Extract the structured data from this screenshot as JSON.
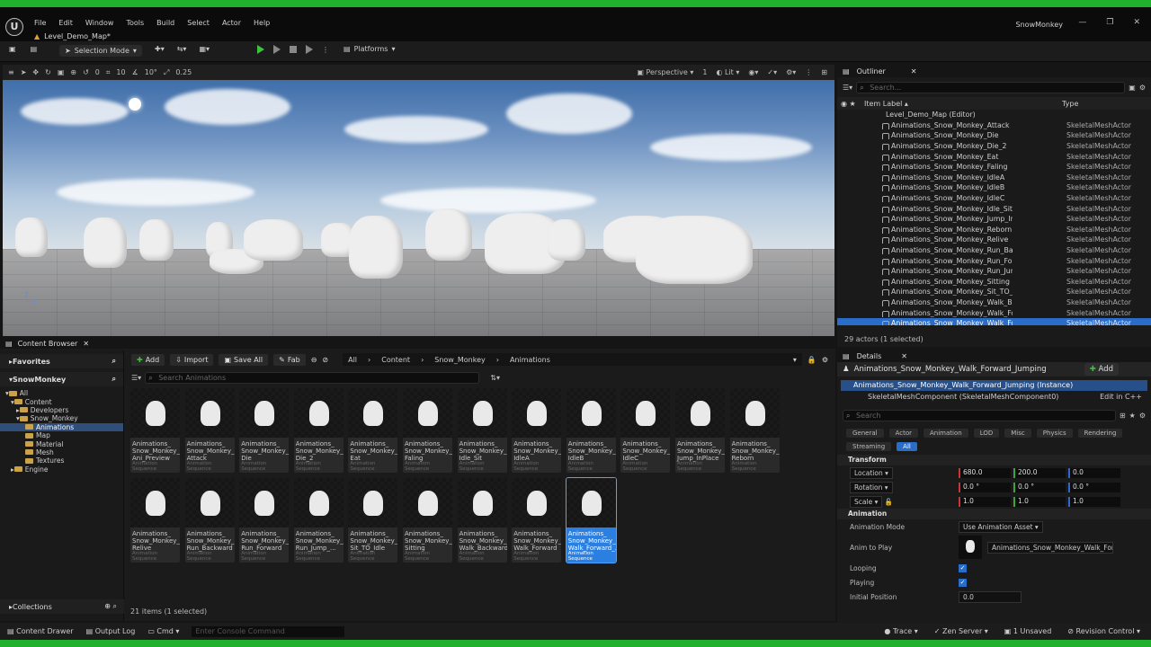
{
  "window": {
    "app_name": "SnowMonkey",
    "map_tab": "Level_Demo_Map*"
  },
  "menu": [
    "File",
    "Edit",
    "Window",
    "Tools",
    "Build",
    "Select",
    "Actor",
    "Help"
  ],
  "toolbar": {
    "selection_mode": "Selection Mode",
    "platforms": "Platforms"
  },
  "viewport": {
    "grid_snap_value": "10",
    "rotation_snap_value": "10°",
    "scale_snap_value": "0.25",
    "axis_value": "0",
    "perspective_label": "Perspective",
    "lit_label": "Lit",
    "view_count": "1"
  },
  "outliner": {
    "title": "Outliner",
    "search_placeholder": "Search...",
    "col_label": "Item Label ▴",
    "col_type": "Type",
    "root": "Level_Demo_Map (Editor)",
    "items": [
      {
        "label": "Animations_Snow_Monkey_Attack",
        "type": "SkeletalMeshActor"
      },
      {
        "label": "Animations_Snow_Monkey_Die",
        "type": "SkeletalMeshActor"
      },
      {
        "label": "Animations_Snow_Monkey_Die_2",
        "type": "SkeletalMeshActor"
      },
      {
        "label": "Animations_Snow_Monkey_Eat",
        "type": "SkeletalMeshActor"
      },
      {
        "label": "Animations_Snow_Monkey_Faling",
        "type": "SkeletalMeshActor"
      },
      {
        "label": "Animations_Snow_Monkey_IdleA",
        "type": "SkeletalMeshActor"
      },
      {
        "label": "Animations_Snow_Monkey_IdleB",
        "type": "SkeletalMeshActor"
      },
      {
        "label": "Animations_Snow_Monkey_IdleC",
        "type": "SkeletalMeshActor"
      },
      {
        "label": "Animations_Snow_Monkey_Idle_Sit",
        "type": "SkeletalMeshActor"
      },
      {
        "label": "Animations_Snow_Monkey_Jump_InPlace",
        "type": "SkeletalMeshActor"
      },
      {
        "label": "Animations_Snow_Monkey_Reborn",
        "type": "SkeletalMeshActor"
      },
      {
        "label": "Animations_Snow_Monkey_Relive",
        "type": "SkeletalMeshActor"
      },
      {
        "label": "Animations_Snow_Monkey_Run_Backward",
        "type": "SkeletalMeshActor"
      },
      {
        "label": "Animations_Snow_Monkey_Run_Forward",
        "type": "SkeletalMeshActor"
      },
      {
        "label": "Animations_Snow_Monkey_Run_Jump_Forward",
        "type": "SkeletalMeshActor"
      },
      {
        "label": "Animations_Snow_Monkey_Sitting",
        "type": "SkeletalMeshActor"
      },
      {
        "label": "Animations_Snow_Monkey_Sit_TO_Idle",
        "type": "SkeletalMeshActor"
      },
      {
        "label": "Animations_Snow_Monkey_Walk_Backward",
        "type": "SkeletalMeshActor"
      },
      {
        "label": "Animations_Snow_Monkey_Walk_Forward",
        "type": "SkeletalMeshActor"
      },
      {
        "label": "Animations_Snow_Monkey_Walk_Forward_Jumping",
        "type": "SkeletalMeshActor"
      }
    ],
    "count": "29 actors (1 selected)"
  },
  "details": {
    "title": "Details",
    "actor": "Animations_Snow_Monkey_Walk_Forward_Jumping",
    "add": "Add",
    "instance": "Animations_Snow_Monkey_Walk_Forward_Jumping (Instance)",
    "component": "SkeletalMeshComponent (SkeletalMeshComponent0)",
    "edit_cpp": "Edit in C++",
    "search_placeholder": "Search",
    "categories": [
      "General",
      "Actor",
      "Animation",
      "LOD",
      "Misc",
      "Physics",
      "Rendering",
      "Streaming",
      "All"
    ],
    "transform_header": "Transform",
    "location_label": "Location",
    "location": [
      "680.0",
      "200.0",
      "0.0"
    ],
    "rotation_label": "Rotation",
    "rotation": [
      "0.0 °",
      "0.0 °",
      "0.0 °"
    ],
    "scale_label": "Scale",
    "scale": [
      "1.0",
      "1.0",
      "1.0"
    ],
    "animation_header": "Animation",
    "anim_mode_label": "Animation Mode",
    "anim_mode": "Use Animation Asset",
    "anim_to_play_label": "Anim to Play",
    "anim_to_play": "Animations_Snow_Monkey_Walk_Forward_",
    "looping_label": "Looping",
    "playing_label": "Playing",
    "initial_position_label": "Initial Position",
    "initial_position": "0.0"
  },
  "content_browser": {
    "tab": "Content Browser",
    "favorites": "Favorites",
    "project": "SnowMonkey",
    "tree": [
      "All",
      "Content",
      "Developers",
      "Snow_Monkey",
      "Animations",
      "Map",
      "Material",
      "Mesh",
      "Textures",
      "Engine"
    ],
    "collections": "Collections",
    "add": "Add",
    "import": "Import",
    "save_all": "Save All",
    "fab": "Fab",
    "crumbs": [
      "All",
      "Content",
      "Snow_Monkey",
      "Animations"
    ],
    "search_placeholder": "Search Animations",
    "asset_type": "Animation Sequence",
    "assets": [
      "Animations_ Snow_Monkey_ Ani_Preview",
      "Animations_ Snow_Monkey_ Attack",
      "Animations_ Snow_Monkey_ Die",
      "Animations_ Snow_Monkey_ Die_2",
      "Animations_ Snow_Monkey_ Eat",
      "Animations_ Snow_Monkey_ Faling",
      "Animations_ Snow_Monkey_ Idle_Sit",
      "Animations_ Snow_Monkey_ IdleA",
      "Animations_ Snow_Monkey_ IdleB",
      "Animations_ Snow_Monkey_ IdleC",
      "Animations_ Snow_Monkey_ Jump_InPlace",
      "Animations_ Snow_Monkey_ Reborn",
      "Animations_ Snow_Monkey_ Relive",
      "Animations_ Snow_Monkey_ Run_Backward",
      "Animations_ Snow_Monkey_ Run_Forward",
      "Animations_ Snow_Monkey_ Run_Jump_...",
      "Animations_ Snow_Monkey_ Sit_TO_Idle",
      "Animations_ Snow_Monkey_ Sitting",
      "Animations_ Snow_Monkey_ Walk_Backward",
      "Animations_ Snow_Monkey_ Walk_Forward",
      "Animations_ Snow_Monkey_ Walk_Forward_..."
    ],
    "status": "21 items (1 selected)"
  },
  "statusbar": {
    "content_drawer": "Content Drawer",
    "output_log": "Output Log",
    "cmd": "Cmd",
    "console_placeholder": "Enter Console Command",
    "trace": "Trace",
    "zen": "Zen Server",
    "unsaved": "1 Unsaved",
    "revision": "Revision Control"
  }
}
